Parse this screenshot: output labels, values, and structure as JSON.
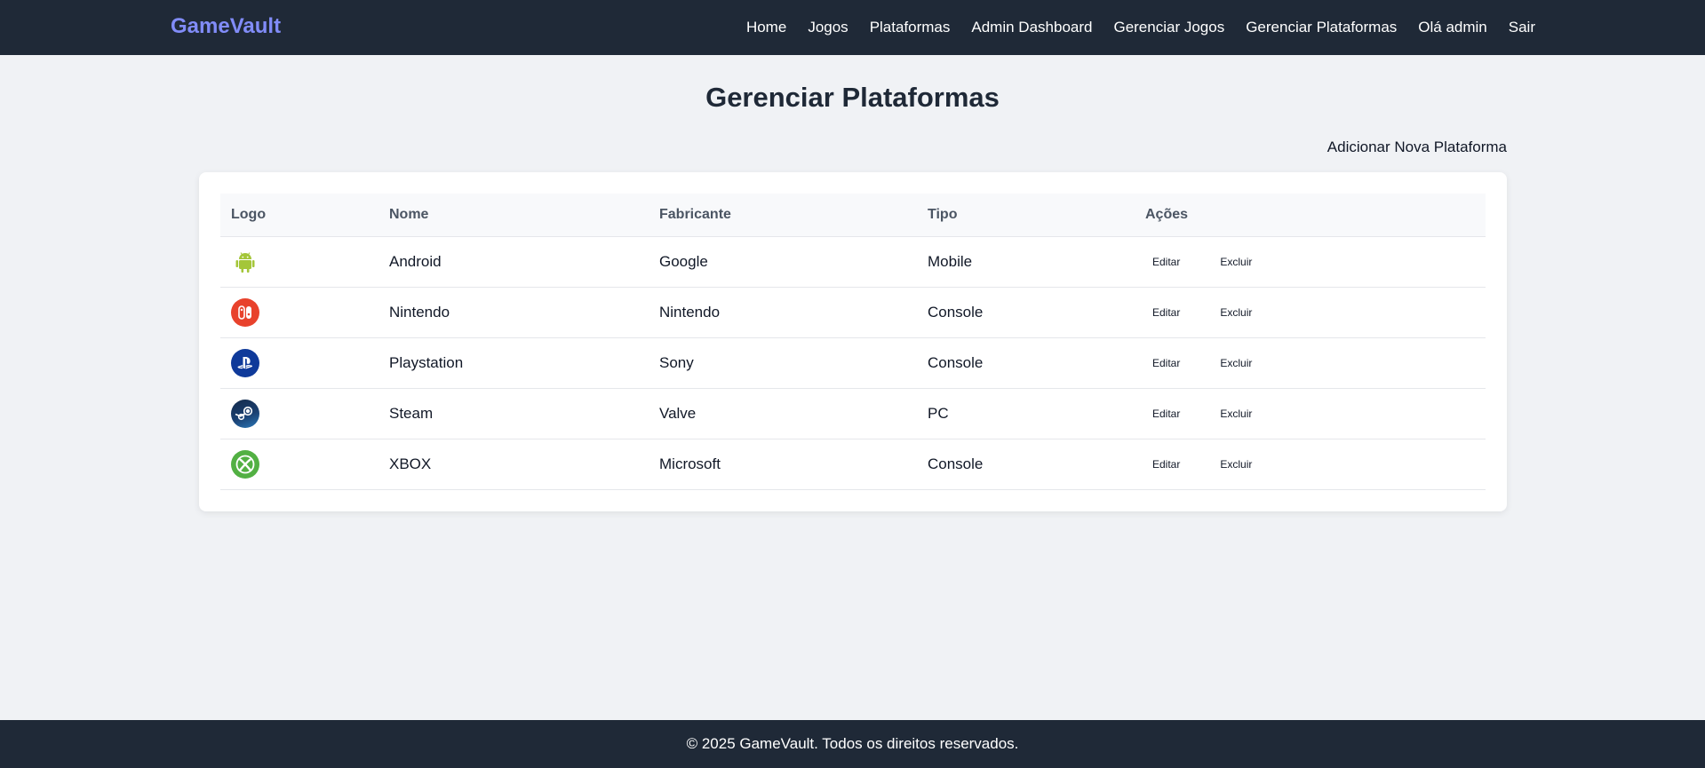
{
  "app": {
    "brand": "GameVault"
  },
  "nav": {
    "items": [
      {
        "label": "Home"
      },
      {
        "label": "Jogos"
      },
      {
        "label": "Plataformas"
      },
      {
        "label": "Admin Dashboard"
      },
      {
        "label": "Gerenciar Jogos"
      },
      {
        "label": "Gerenciar Plataformas"
      },
      {
        "label": "Olá admin"
      },
      {
        "label": "Sair"
      }
    ]
  },
  "page": {
    "title": "Gerenciar Plataformas",
    "add_label": "Adicionar Nova Plataforma"
  },
  "table": {
    "headers": [
      "Logo",
      "Nome",
      "Fabricante",
      "Tipo",
      "Ações"
    ],
    "rows": [
      {
        "logo_icon": "android-icon",
        "logo_color": "#a4c639",
        "nome": "Android",
        "fabricante": "Google",
        "tipo": "Mobile",
        "edit_label": "Editar",
        "delete_label": "Excluir"
      },
      {
        "logo_icon": "nintendo-switch-icon",
        "logo_color": "#e60012",
        "nome": "Nintendo",
        "fabricante": "Nintendo",
        "tipo": "Console",
        "edit_label": "Editar",
        "delete_label": "Excluir"
      },
      {
        "logo_icon": "playstation-icon",
        "logo_color": "#003791",
        "nome": "Playstation",
        "fabricante": "Sony",
        "tipo": "Console",
        "edit_label": "Editar",
        "delete_label": "Excluir"
      },
      {
        "logo_icon": "steam-icon",
        "logo_color": "#1b2838",
        "nome": "Steam",
        "fabricante": "Valve",
        "tipo": "PC",
        "edit_label": "Editar",
        "delete_label": "Excluir"
      },
      {
        "logo_icon": "xbox-icon",
        "logo_color": "#52b043",
        "nome": "XBOX",
        "fabricante": "Microsoft",
        "tipo": "Console",
        "edit_label": "Editar",
        "delete_label": "Excluir"
      }
    ]
  },
  "footer": {
    "text": "© 2025 GameVault. Todos os direitos reservados."
  },
  "colors": {
    "navbar_bg": "#1f2937",
    "brand": "#818cf8",
    "page_bg": "#f0f2f5"
  }
}
